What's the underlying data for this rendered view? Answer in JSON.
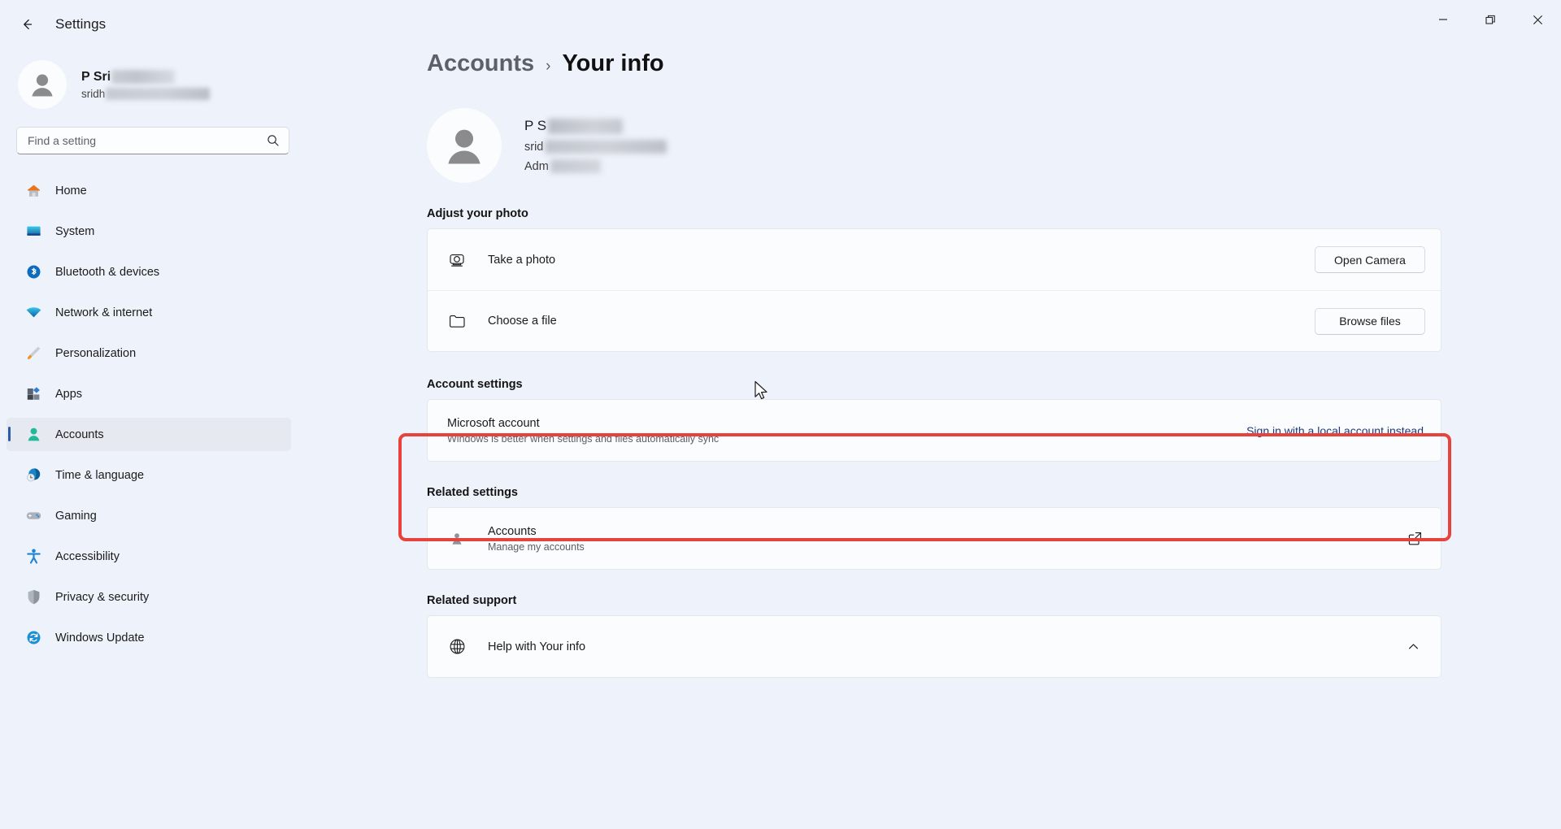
{
  "window": {
    "title": "Settings",
    "back_icon": "back-arrow-icon",
    "minimize_label": "Minimize",
    "maximize_label": "Restore",
    "close_label": "Close"
  },
  "sidebar": {
    "profile": {
      "name_visible": "P Sri",
      "email_visible": "sridh",
      "avatar_icon": "person-avatar-icon"
    },
    "search": {
      "placeholder": "Find a setting",
      "value": "",
      "icon": "search-icon"
    },
    "items": [
      {
        "label": "Home",
        "icon": "home-icon",
        "active": false
      },
      {
        "label": "System",
        "icon": "system-display-icon",
        "active": false
      },
      {
        "label": "Bluetooth & devices",
        "icon": "bluetooth-icon",
        "active": false
      },
      {
        "label": "Network & internet",
        "icon": "wifi-icon",
        "active": false
      },
      {
        "label": "Personalization",
        "icon": "paintbrush-icon",
        "active": false
      },
      {
        "label": "Apps",
        "icon": "apps-icon",
        "active": false
      },
      {
        "label": "Accounts",
        "icon": "accounts-person-icon",
        "active": true
      },
      {
        "label": "Time & language",
        "icon": "clock-globe-icon",
        "active": false
      },
      {
        "label": "Gaming",
        "icon": "gamepad-icon",
        "active": false
      },
      {
        "label": "Accessibility",
        "icon": "accessibility-person-icon",
        "active": false
      },
      {
        "label": "Privacy & security",
        "icon": "shield-icon",
        "active": false
      },
      {
        "label": "Windows Update",
        "icon": "update-refresh-icon",
        "active": false
      }
    ]
  },
  "main": {
    "breadcrumb": {
      "parent": "Accounts",
      "separator": "›",
      "current": "Your info"
    },
    "hero": {
      "name_visible": "P S",
      "email_visible": "srid",
      "role_visible": "Adm",
      "avatar_icon": "person-avatar-icon"
    },
    "adjust_photo": {
      "heading": "Adjust your photo",
      "rows": [
        {
          "title": "Take a photo",
          "icon": "camera-icon",
          "button": "Open Camera"
        },
        {
          "title": "Choose a file",
          "icon": "folder-icon",
          "button": "Browse files"
        }
      ]
    },
    "account_settings": {
      "heading": "Account settings",
      "row": {
        "title": "Microsoft account",
        "subtitle": "Windows is better when settings and files automatically sync",
        "link": "Sign in with a local account instead"
      },
      "highlight_color": "#e8423c"
    },
    "related_settings": {
      "heading": "Related settings",
      "row": {
        "title": "Accounts",
        "subtitle": "Manage my accounts",
        "icon": "person-small-icon",
        "trailing_icon": "external-link-icon"
      }
    },
    "related_support": {
      "heading": "Related support",
      "row": {
        "title": "Help with Your info",
        "icon": "globe-help-icon",
        "trailing_icon": "chevron-up-icon"
      }
    }
  },
  "colors": {
    "page_background": "#eef2fa",
    "card_background": "#fbfcfe",
    "accent_selection": "#2a5ca8",
    "link": "#1b3a7a",
    "highlight_red": "#e8423c"
  }
}
